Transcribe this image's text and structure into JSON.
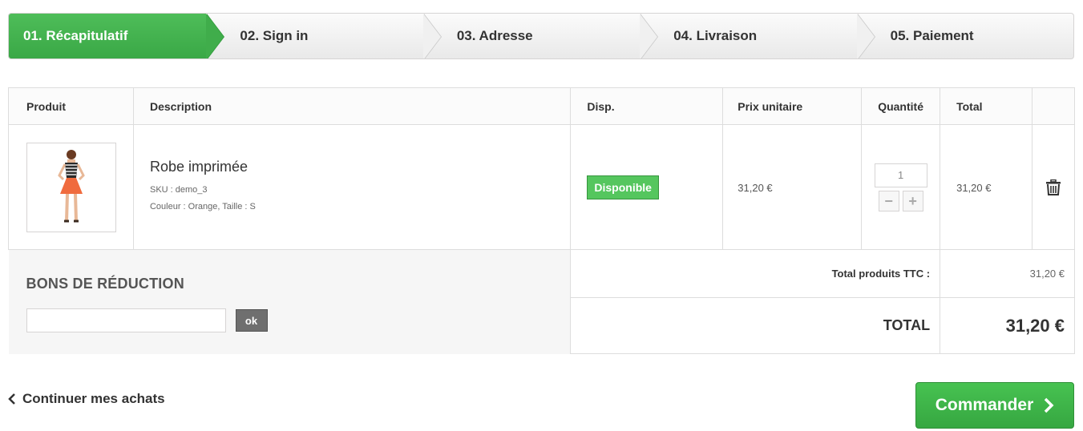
{
  "steps": [
    {
      "label": "01. Récapitulatif",
      "active": true
    },
    {
      "label": "02. Sign in",
      "active": false
    },
    {
      "label": "03. Adresse",
      "active": false
    },
    {
      "label": "04. Livraison",
      "active": false
    },
    {
      "label": "05. Paiement",
      "active": false
    }
  ],
  "table": {
    "headers": {
      "product": "Produit",
      "description": "Description",
      "availability": "Disp.",
      "unit_price": "Prix unitaire",
      "quantity": "Quantité",
      "total": "Total"
    },
    "item": {
      "name": "Robe imprimée",
      "sku": "SKU : demo_3",
      "attributes": "Couleur : Orange, Taille : S",
      "availability": "Disponible",
      "unit_price": "31,20 €",
      "quantity": "1",
      "total": "31,20 €"
    }
  },
  "voucher": {
    "title": "BONS DE RÉDUCTION",
    "button": "ok",
    "input_value": ""
  },
  "totals": {
    "products_label": "Total produits TTC :",
    "products_value": "31,20 €",
    "grand_label": "TOTAL",
    "grand_value": "31,20 €"
  },
  "nav": {
    "continue": "Continuer mes achats",
    "order": "Commander"
  },
  "colors": {
    "accent_green": "#46a74e",
    "badge_green": "#55c65e",
    "ok_button": "#6f6f6f"
  },
  "icons": {
    "remove": "trash-icon",
    "continue": "chevron-left-icon",
    "order": "chevron-right-icon",
    "qty_down": "minus-icon",
    "qty_up": "plus-icon"
  }
}
